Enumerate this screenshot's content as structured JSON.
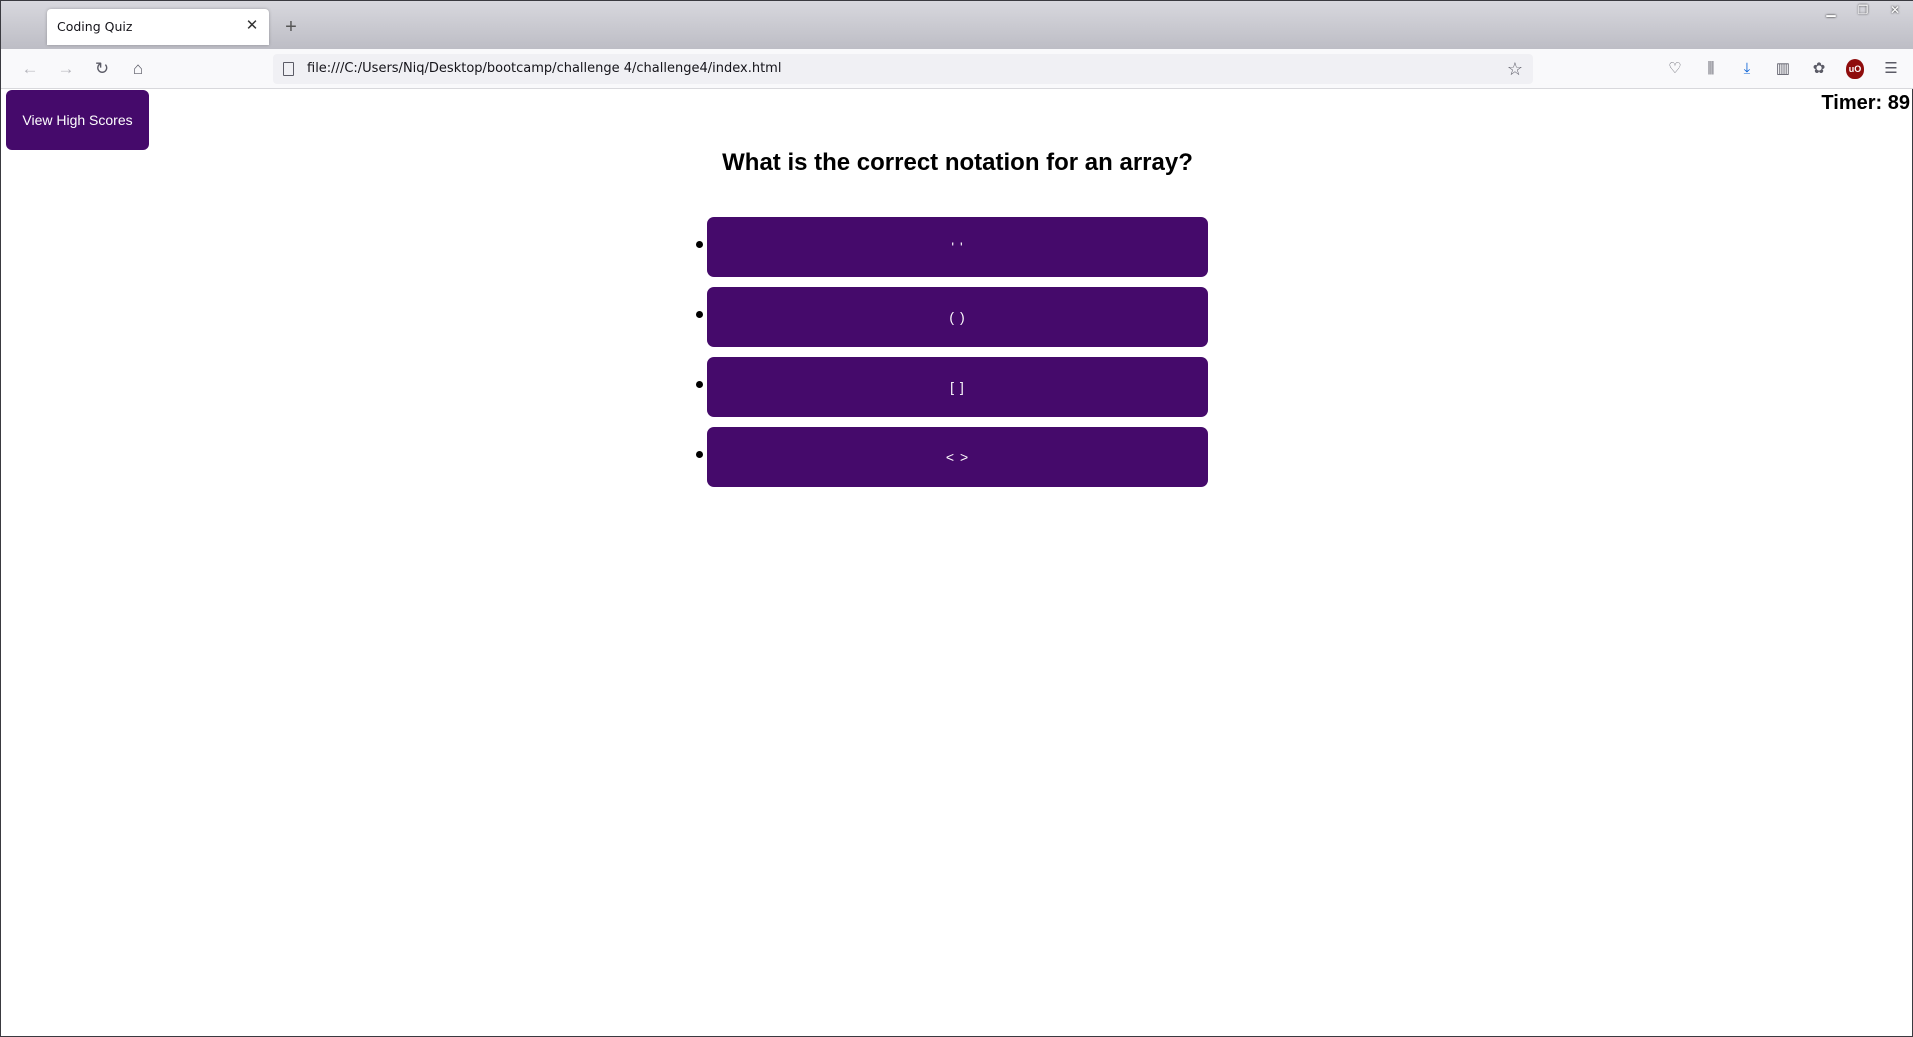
{
  "browser": {
    "tab_title": "Coding Quiz",
    "tab_close_icon": "close-icon",
    "new_tab_icon": "plus-icon",
    "url": "file:///C:/Users/Niq/Desktop/bootcamp/challenge 4/challenge4/index.html"
  },
  "page": {
    "high_scores_label": "View High Scores",
    "timer_text": "Timer: 89",
    "question": "What is the correct notation for an array?",
    "answers": [
      " ' ' ",
      "( )",
      "[ ]",
      "< >"
    ],
    "accent_color": "#450a6b"
  }
}
